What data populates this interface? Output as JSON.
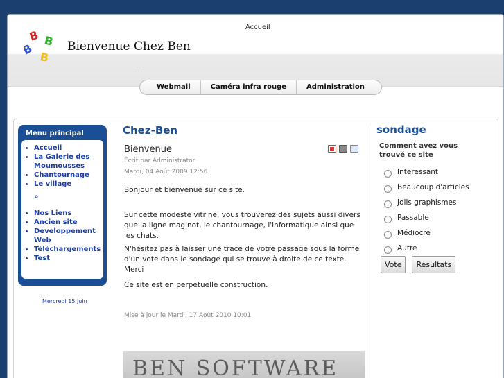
{
  "header": {
    "top_link": "Accueil",
    "site_title": "Bienvenue Chez Ben",
    "dots": "· ·"
  },
  "topnav": [
    "Webmail",
    "Caméra infra rouge",
    "Administration"
  ],
  "menu": {
    "title": "Menu principal",
    "items_top": [
      "Accueil",
      "La Galerie des Moumousses",
      "Chantournage",
      "Le village"
    ],
    "items_bottom": [
      "Nos Liens",
      "Ancien site",
      "Developpement Web",
      "Téléchargements",
      "Test"
    ]
  },
  "date_small": "Mercredi 15 Juin",
  "article": {
    "section": "Chez-Ben",
    "title": "Bienvenue",
    "author": "Écrit par Administrator",
    "date": "Mardi, 04 Août 2009 12:56",
    "paragraphs": [
      "Bonjour et bienvenue sur ce site.",
      "Sur cette modeste vitrine, vous trouverez des sujets aussi divers que la ligne maginot, le chantournage, l'informatique ainsi que les chats.",
      "N'hésitez pas à laisser une trace de votre passage sous la forme d'un vote dans le sondage qui se trouve à droite de ce texte. Merci",
      "Ce site est en perpetuelle construction."
    ],
    "updated": "Mise à jour le Mardi, 17 Août 2010 10:01",
    "banner": "BEN SOFTWARE"
  },
  "poll": {
    "title": "sondage",
    "question": "Comment avez vous trouvé ce site",
    "options": [
      "Interessant",
      "Beaucoup d'articles",
      "Jolis graphismes",
      "Passable",
      "Médiocre",
      "Autre"
    ],
    "vote_label": "Vote",
    "results_label": "Résultats"
  }
}
